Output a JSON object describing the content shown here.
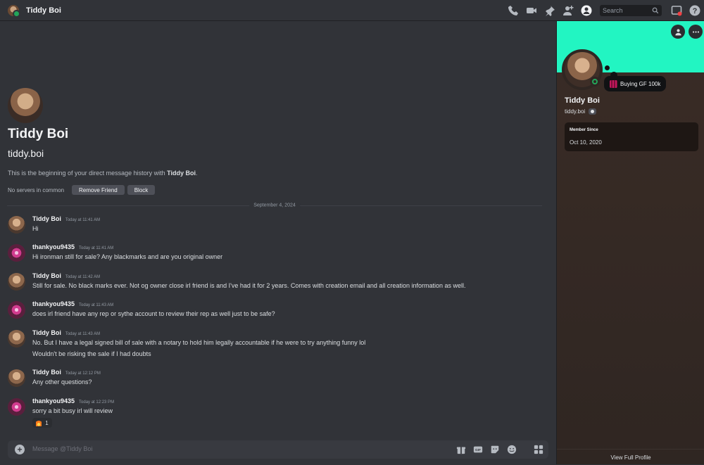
{
  "topbar": {
    "title": "Tiddy Boi",
    "search_placeholder": "Search",
    "icons": [
      "phone-call-icon",
      "video-call-icon",
      "pin-icon",
      "add-friends-icon",
      "user-profile-icon",
      "search-icon",
      "inbox-icon",
      "help-icon"
    ]
  },
  "intro": {
    "name": "Tiddy Boi",
    "handle": "tiddy.boi",
    "text_prefix": "This is the beginning of your direct message history with ",
    "text_name": "Tiddy Boi",
    "text_suffix": ".",
    "no_servers": "No servers in common",
    "remove_friend": "Remove Friend",
    "block": "Block"
  },
  "date_divider": "September 4, 2024",
  "messages": [
    {
      "author": "Tiddy Boi",
      "time": "Today at 11:41 AM",
      "lines": [
        "Hi"
      ]
    },
    {
      "author": "thankyou9435",
      "time": "Today at 11:41 AM",
      "lines": [
        "Hi ironman still for sale? Any blackmarks and are you original owner"
      ]
    },
    {
      "author": "Tiddy Boi",
      "time": "Today at 11:42 AM",
      "lines": [
        "Still for sale. No black marks ever. Not og owner close irl friend is and I've had it for 2 years. Comes with creation email and all creation information as well."
      ]
    },
    {
      "author": "thankyou9435",
      "time": "Today at 11:43 AM",
      "lines": [
        "does irl friend have any rep or sythe account to review their rep as well just to be safe?"
      ]
    },
    {
      "author": "Tiddy Boi",
      "time": "Today at 11:43 AM",
      "lines": [
        "No. But I have a legal signed bill of sale with a notary to hold him legally accountable if he were to try anything funny lol",
        "Wouldn't be risking the sale if I had doubts"
      ]
    },
    {
      "author": "Tiddy Boi",
      "time": "Today at 12:12 PM",
      "lines": [
        "Any other questions?"
      ]
    },
    {
      "author": "thankyou9435",
      "time": "Today at 12:23 PM",
      "lines": [
        "sorry a bit busy irl will review"
      ],
      "reaction": {
        "emoji": "fire-emoji",
        "count": "1"
      }
    }
  ],
  "composer": {
    "placeholder": "Message @Tiddy Boi",
    "icons": [
      "gift-icon",
      "gif-icon",
      "sticker-icon",
      "emoji-icon",
      "apps-icon"
    ]
  },
  "profile": {
    "banner_color": "#22f5c2",
    "name": "Tiddy Boi",
    "handle": "tiddy.boi",
    "status_text": "Buying GF 100k",
    "member_since_label": "Member Since",
    "member_since_value": "Oct 10, 2020",
    "view_full": "View Full Profile"
  },
  "colors": {
    "background": "#313338",
    "online": "#23a55a",
    "panel": "#3a2c26"
  }
}
